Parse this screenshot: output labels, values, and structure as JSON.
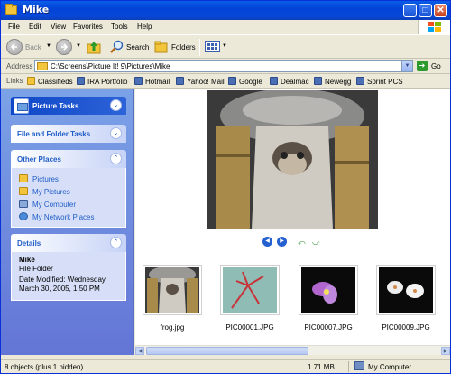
{
  "window": {
    "title": "Mike",
    "min": "_",
    "max": "□",
    "close": "✕"
  },
  "menu": [
    "File",
    "Edit",
    "View",
    "Favorites",
    "Tools",
    "Help"
  ],
  "toolbar": {
    "back": "Back",
    "search": "Search",
    "folders": "Folders"
  },
  "address": {
    "label": "Address",
    "path": "C:\\Screens\\Picture It! 9\\Pictures\\Mike",
    "go": "Go"
  },
  "links": {
    "label": "Links",
    "items": [
      "Classifieds",
      "IRA Portfolio",
      "Hotmail",
      "Yahoo! Mail",
      "Google",
      "Dealmac",
      "Newegg",
      "Sprint PCS"
    ]
  },
  "taskpane": {
    "picture_tasks": "Picture Tasks",
    "file_folder_tasks": "File and Folder Tasks",
    "other_places": {
      "title": "Other Places",
      "items": [
        "Pictures",
        "My Pictures",
        "My Computer",
        "My Network Places"
      ]
    },
    "details": {
      "title": "Details",
      "name": "Mike",
      "type": "File Folder",
      "modified": "Date Modified: Wednesday, March 30, 2005, 1:50 PM"
    }
  },
  "thumbnails": [
    "frog.jpg",
    "PIC00001.JPG",
    "PIC00007.JPG",
    "PIC00009.JPG"
  ],
  "status": {
    "objects": "8 objects (plus 1 hidden)",
    "size": "1.71 MB",
    "location": "My Computer"
  },
  "colors": {
    "titlebar": "#0343d8",
    "taskpane": "#6375d6",
    "link": "#215dc6"
  }
}
